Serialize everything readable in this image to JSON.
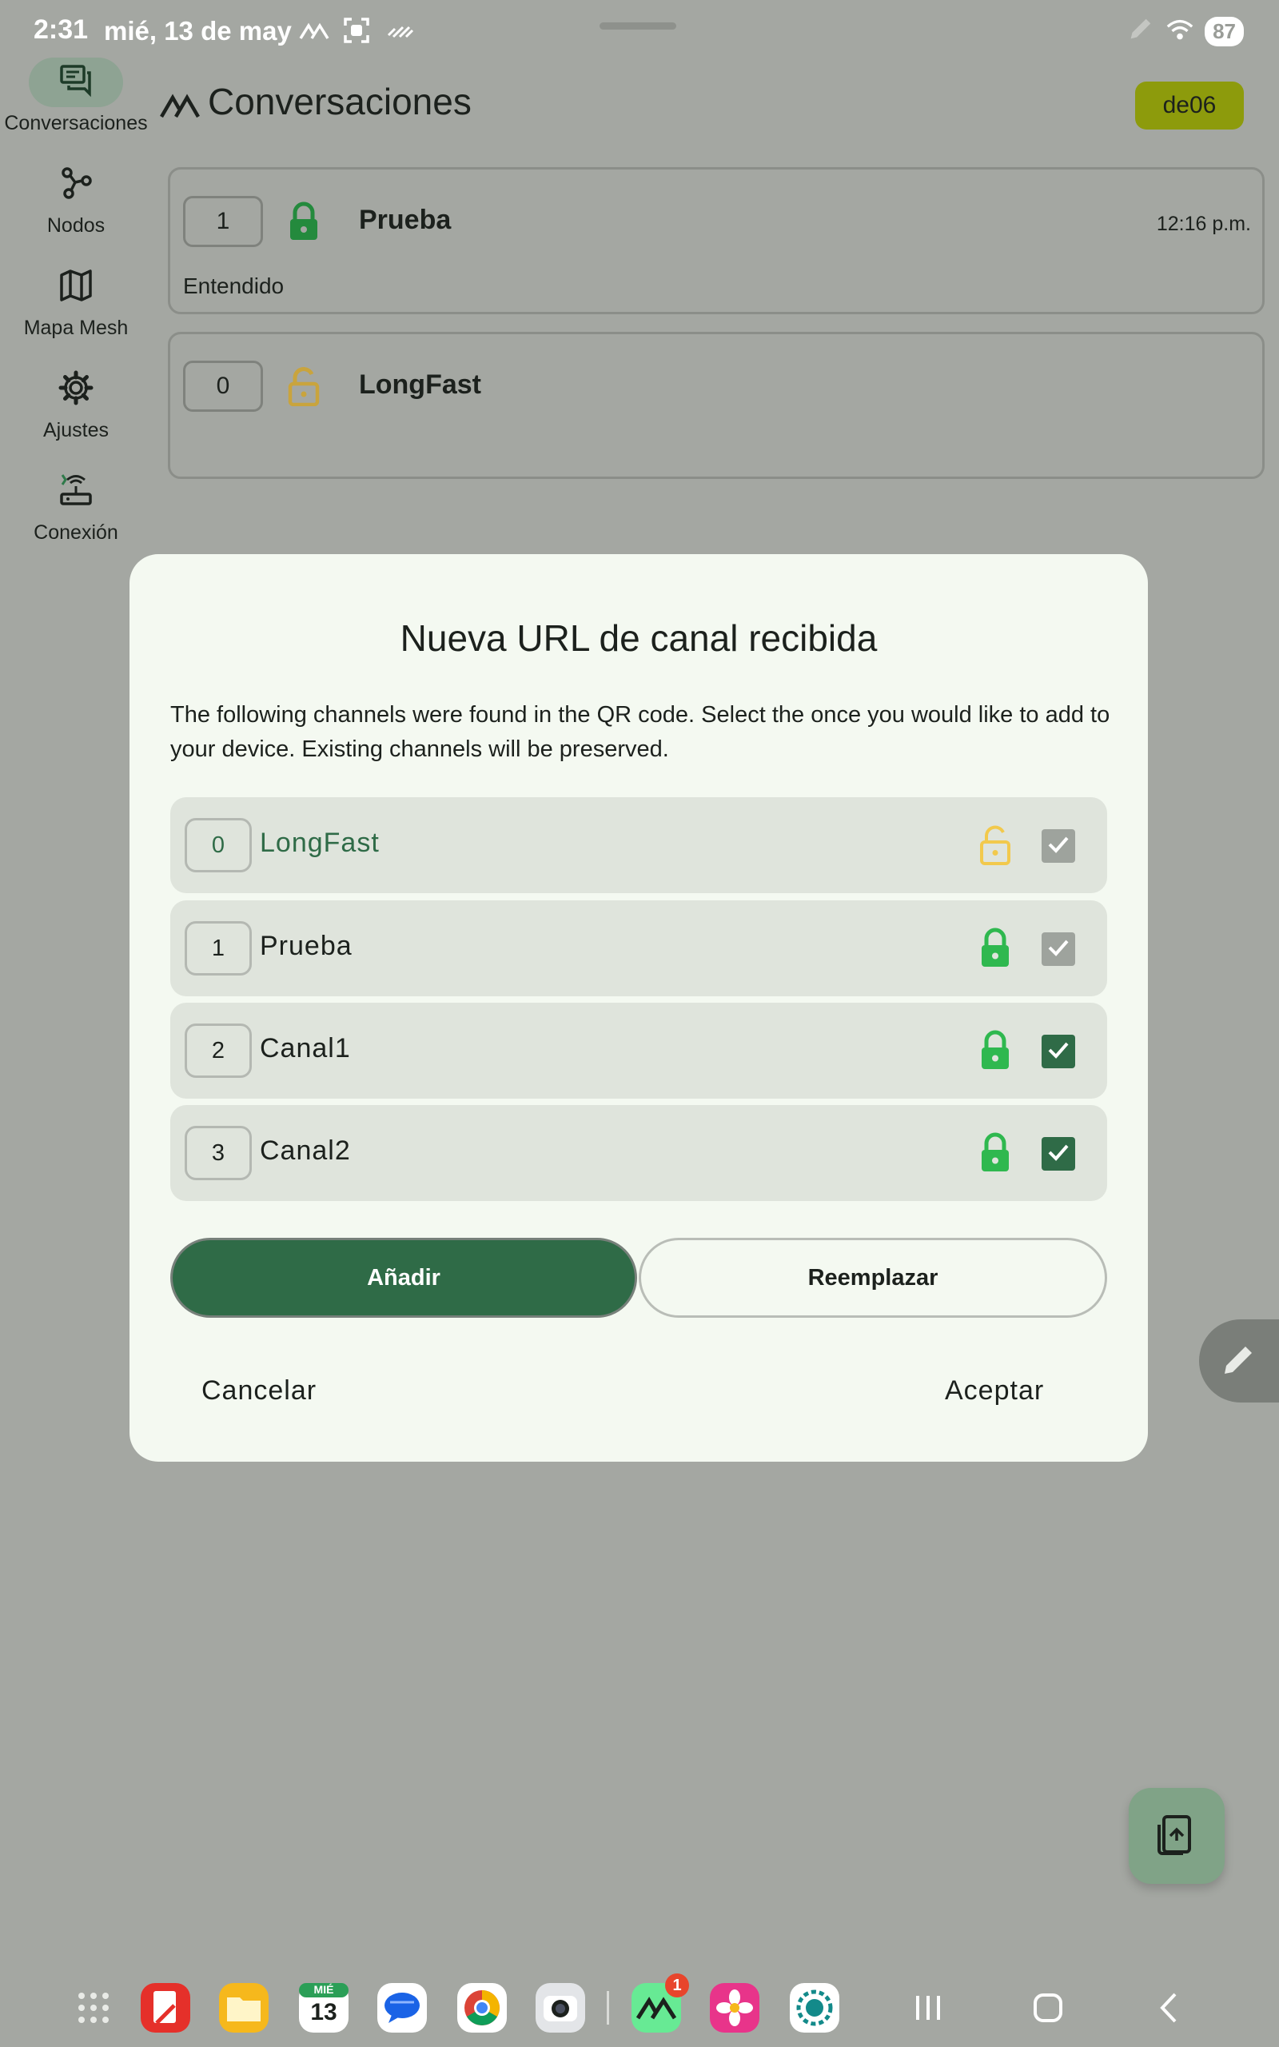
{
  "status_bar": {
    "time": "2:31",
    "date": "mié, 13 de may",
    "battery": "87"
  },
  "nav_rail": {
    "items": [
      {
        "label": "Conversaciones",
        "icon": "chat-icon",
        "active": true
      },
      {
        "label": "Nodos",
        "icon": "nodes-icon",
        "active": false
      },
      {
        "label": "Mapa Mesh",
        "icon": "map-icon",
        "active": false
      },
      {
        "label": "Ajustes",
        "icon": "gear-icon",
        "active": false
      },
      {
        "label": "Conexión",
        "icon": "router-icon",
        "active": false
      }
    ]
  },
  "header": {
    "title": "Conversaciones",
    "node_chip": "de06"
  },
  "conversations": [
    {
      "channel_index": "1",
      "name": "Prueba",
      "time": "12:16 p.m.",
      "last_message": "Entendido",
      "lock": "locked-green"
    },
    {
      "channel_index": "0",
      "name": "LongFast",
      "time": "",
      "last_message": "",
      "lock": "unlocked-yellow"
    }
  ],
  "dialog": {
    "title": "Nueva URL de canal recibida",
    "description": "The following channels were found in the QR code. Select the once you would like to add to your device. Existing channels will be preserved.",
    "channels": [
      {
        "index": "0",
        "name": "LongFast",
        "lock": "unlocked-yellow",
        "checked": true,
        "enabled": false
      },
      {
        "index": "1",
        "name": "Prueba",
        "lock": "locked-green",
        "checked": true,
        "enabled": false
      },
      {
        "index": "2",
        "name": "Canal1",
        "lock": "locked-green",
        "checked": true,
        "enabled": true
      },
      {
        "index": "3",
        "name": "Canal2",
        "lock": "locked-green",
        "checked": true,
        "enabled": true
      }
    ],
    "add_label": "Añadir",
    "replace_label": "Reemplazar",
    "cancel_label": "Cancelar",
    "accept_label": "Aceptar"
  },
  "taskbar": {
    "calendar_month": "MIÉ",
    "calendar_day": "13",
    "meshtastic_badge": "1"
  },
  "colors": {
    "primary": "#2f6b47",
    "lock_green": "#2fb84f",
    "lock_yellow": "#f2c94c",
    "chip": "#8d9b0c"
  }
}
